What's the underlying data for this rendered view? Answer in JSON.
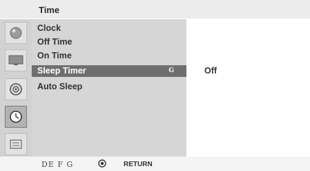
{
  "header": {
    "title": "Time"
  },
  "sidebar": {
    "icons": [
      {
        "name": "picture-icon"
      },
      {
        "name": "screen-icon"
      },
      {
        "name": "audio-icon"
      },
      {
        "name": "clock-icon",
        "active": true
      },
      {
        "name": "option-icon"
      }
    ]
  },
  "menu": {
    "items": [
      {
        "label": "Clock"
      },
      {
        "label": "Off Time"
      },
      {
        "label": "On Time"
      },
      {
        "label": "Sleep Timer",
        "selected": true,
        "hint": "G"
      },
      {
        "label": "Auto Sleep"
      }
    ]
  },
  "value_panel": {
    "value": "Off"
  },
  "footer": {
    "keys": "DE F G",
    "return_label": "RETURN"
  }
}
